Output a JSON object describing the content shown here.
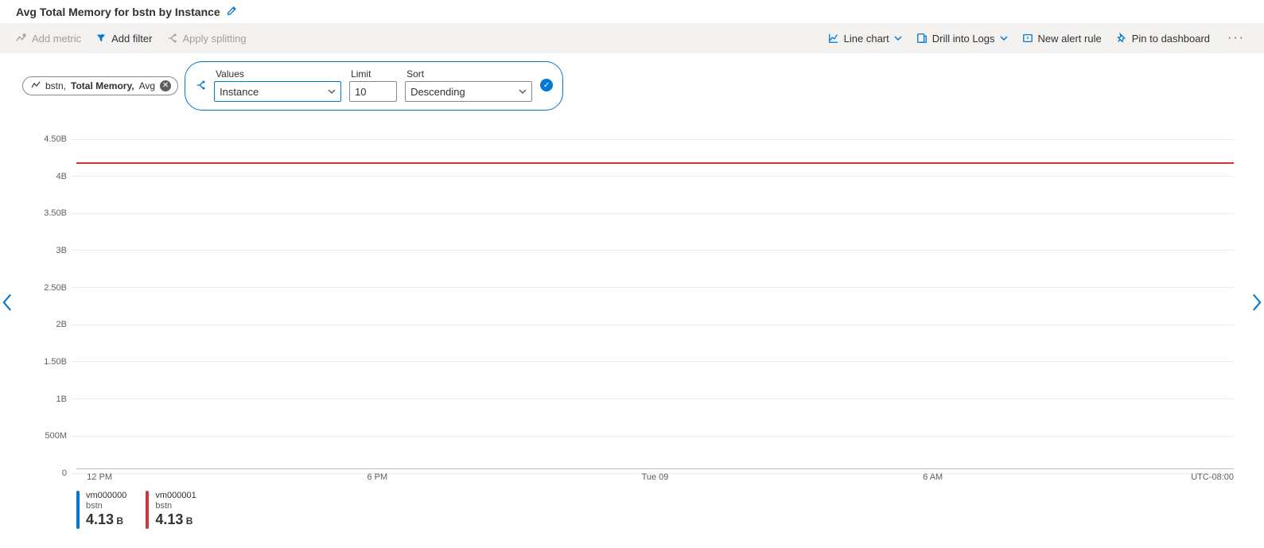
{
  "header": {
    "title": "Avg Total Memory for bstn by Instance"
  },
  "toolbar": {
    "add_metric": "Add metric",
    "add_filter": "Add filter",
    "apply_splitting": "Apply splitting",
    "line_chart": "Line chart",
    "drill_logs": "Drill into Logs",
    "new_alert": "New alert rule",
    "pin": "Pin to dashboard"
  },
  "metric_pill": {
    "resource": "bstn,",
    "metric": "Total Memory,",
    "agg": "Avg"
  },
  "split": {
    "values_label": "Values",
    "values_value": "Instance",
    "limit_label": "Limit",
    "limit_value": "10",
    "sort_label": "Sort",
    "sort_value": "Descending"
  },
  "chart_data": {
    "type": "line",
    "title": "Avg Total Memory for bstn by Instance",
    "xlabel": "",
    "ylabel": "",
    "ylim": [
      0,
      4500000000
    ],
    "y_ticks": [
      "4.50B",
      "4B",
      "3.50B",
      "3B",
      "2.50B",
      "2B",
      "1.50B",
      "1B",
      "500M",
      "0"
    ],
    "x_ticks": [
      "12 PM",
      "6 PM",
      "Tue 09",
      "6 AM"
    ],
    "timezone": "UTC-08:00",
    "x": [
      "12 PM",
      "6 PM",
      "Tue 09",
      "6 AM"
    ],
    "series": [
      {
        "name": "vm000000",
        "resource": "bstn",
        "color": "#0078d4",
        "values": [
          4130000000.0,
          4130000000.0,
          4130000000.0,
          4130000000.0
        ]
      },
      {
        "name": "vm000001",
        "resource": "bstn",
        "color": "#d13438",
        "values": [
          4130000000.0,
          4130000000.0,
          4130000000.0,
          4130000000.0
        ]
      }
    ]
  },
  "legend": [
    {
      "name": "vm000000",
      "resource": "bstn",
      "value": "4.13",
      "unit": "B",
      "color": "#0078d4"
    },
    {
      "name": "vm000001",
      "resource": "bstn",
      "value": "4.13",
      "unit": "B",
      "color": "#d13438"
    }
  ]
}
